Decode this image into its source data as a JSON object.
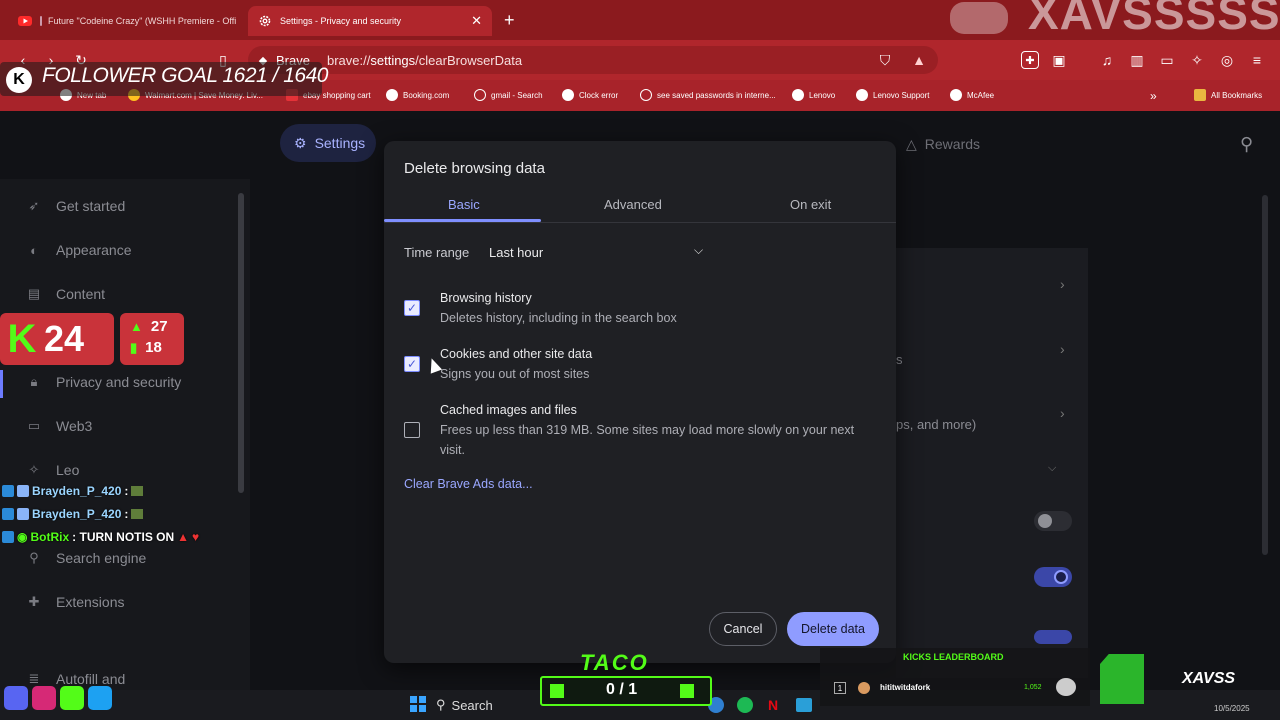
{
  "browser": {
    "tabs": [
      {
        "title": "Future \"Codeine Crazy\" (WSHH Premiere - Official",
        "active": false
      },
      {
        "title": "Settings - Privacy and security",
        "active": true
      }
    ],
    "brand_label": "Brave",
    "url_prefix": "brave://",
    "url_host": "settings",
    "url_path": "/clearBrowserData",
    "colors": {
      "tabbar": "#8b1a1e",
      "toolbar": "#b0262c",
      "accent": "#8f9cff"
    },
    "bookmarks": [
      {
        "label": "New tab"
      },
      {
        "label": "Walmart.com | Save Money. Liv..."
      },
      {
        "label": "ebay shopping cart"
      },
      {
        "label": "Booking.com"
      },
      {
        "label": "gmail - Search"
      },
      {
        "label": "Clock error"
      },
      {
        "label": "see saved passwords in interne..."
      },
      {
        "label": "Lenovo"
      },
      {
        "label": "Lenovo Support"
      },
      {
        "label": "McAfee"
      }
    ],
    "all_bookmarks": "All Bookmarks",
    "watermark": "XAVSSSSS"
  },
  "settings": {
    "header_title": "Settings",
    "header_rewards": "Rewards",
    "sidebar": [
      {
        "label": "Get started",
        "icon": "rocket-icon"
      },
      {
        "label": "Appearance",
        "icon": "palette-icon"
      },
      {
        "label": "Content",
        "icon": "content-icon"
      },
      {
        "label": "Privacy and security",
        "icon": "lock-icon"
      },
      {
        "label": "Web3",
        "icon": "wallet-icon"
      },
      {
        "label": "Leo",
        "icon": "sparkle-icon"
      },
      {
        "label": "Search engine",
        "icon": "search-icon"
      },
      {
        "label": "Extensions",
        "icon": "puzzle-icon"
      },
      {
        "label": "Autofill and",
        "icon": "autofill-icon"
      }
    ],
    "background_snippets": [
      "s",
      "ps, and more)"
    ]
  },
  "dialog": {
    "title": "Delete browsing data",
    "tabs": [
      "Basic",
      "Advanced",
      "On exit"
    ],
    "active_tab": "Basic",
    "time_range_label": "Time range",
    "time_range_value": "Last hour",
    "options": [
      {
        "title": "Browsing history",
        "description": "Deletes history, including in the search box",
        "checked": true
      },
      {
        "title": "Cookies and other site data",
        "description": "Signs you out of most sites",
        "checked": true
      },
      {
        "title": "Cached images and files",
        "description": "Frees up less than 319 MB. Some sites may load more slowly on your next visit.",
        "checked": false
      }
    ],
    "ads_link": "Clear Brave Ads data...",
    "cancel_label": "Cancel",
    "delete_label": "Delete data"
  },
  "stream_overlay": {
    "follower_goal": "FOLLOWER GOAL 1621 / 1640",
    "kick_viewers": "24",
    "stat_up": "27",
    "stat_bars": "18",
    "chat": [
      {
        "user": "Brayden_P_420",
        "message": ":"
      },
      {
        "user": "Brayden_P_420",
        "message": ":"
      },
      {
        "user": "BotRix",
        "message": ": TURN NOTIS ON"
      }
    ],
    "goal_title": "TACO",
    "goal_count": "0 / 1",
    "leaderboard_title": "KICKS LEADERBOARD",
    "leaderboard": [
      {
        "rank": "1",
        "user": "hititwitdafork",
        "count": "1,052"
      }
    ],
    "brand": "XAVSS"
  },
  "taskbar": {
    "search_label": "Search",
    "date": "10/5/2025"
  }
}
